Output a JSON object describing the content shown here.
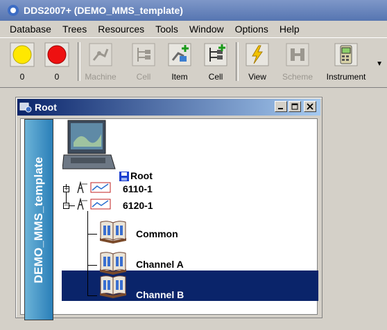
{
  "app": {
    "title": "DDS2007+ (DEMO_MMS_template)"
  },
  "menu": [
    "Database",
    "Trees",
    "Resources",
    "Tools",
    "Window",
    "Options",
    "Help"
  ],
  "toolbar": {
    "yellow_count": "0",
    "red_count": "0",
    "machine": "Machine",
    "cell_disabled": "Cell",
    "item": "Item",
    "cell": "Cell",
    "view": "View",
    "scheme": "Scheme",
    "instrument": "Instrument"
  },
  "child": {
    "title": "Root",
    "banner": "DEMO_MMS_template",
    "tree": {
      "root": "Root",
      "node1": "6110-1",
      "node2": "6120-1",
      "children": [
        "Common",
        "Channel A",
        "Channel B"
      ]
    }
  },
  "colors": {
    "selection": "#0a246a",
    "banner": "#2a7fb8",
    "title_bar": "#5675b1"
  }
}
